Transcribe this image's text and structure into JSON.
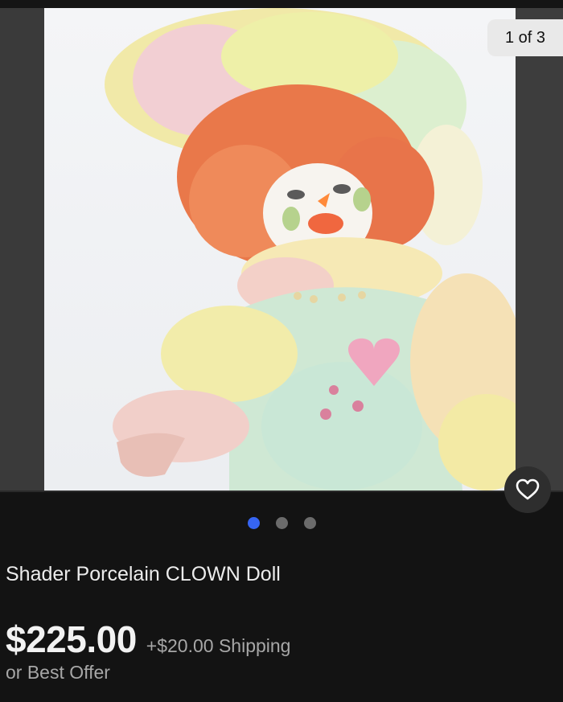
{
  "gallery": {
    "counter": "1 of 3",
    "image_alt": "Porcelain clown doll with orange hair and pastel costume",
    "dots": [
      {
        "active": true
      },
      {
        "active": false
      },
      {
        "active": false
      }
    ],
    "accent_color": "#3665f3"
  },
  "listing": {
    "title": "Shader Porcelain CLOWN Doll",
    "price": "$225.00",
    "shipping": "+$20.00 Shipping",
    "offer": "or Best Offer"
  },
  "icons": {
    "favorite": "heart-outline-icon"
  }
}
